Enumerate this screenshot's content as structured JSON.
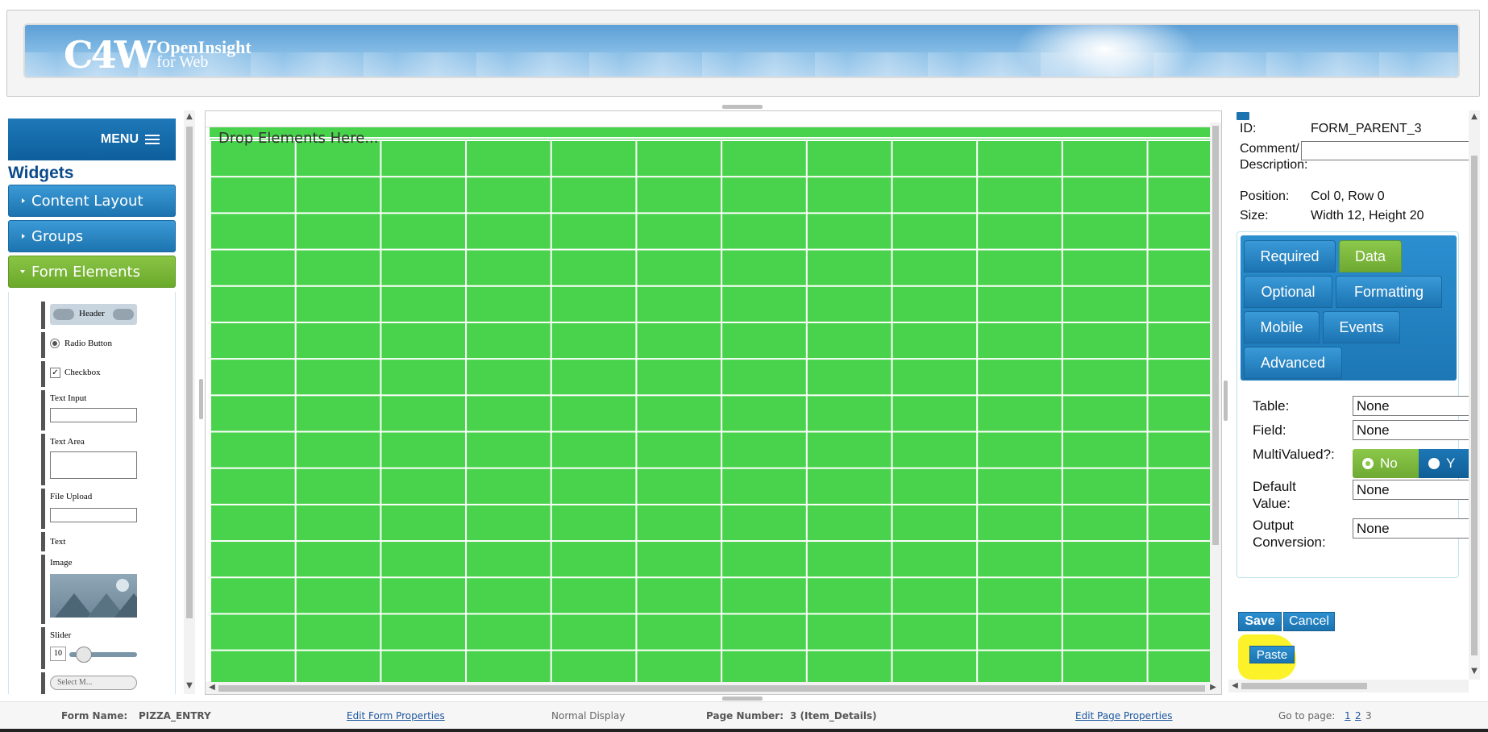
{
  "banner": {
    "logo_mark": "C4W",
    "logo_line1": "OpenInsight",
    "logo_line2": "for Web"
  },
  "left_panel": {
    "menu_label": "MENU",
    "widgets_title": "Widgets",
    "accordion": [
      {
        "label": "Content Layout",
        "state": "collapsed"
      },
      {
        "label": "Groups",
        "state": "collapsed"
      },
      {
        "label": "Form Elements",
        "state": "expanded"
      }
    ],
    "elements": {
      "header": "Header",
      "radio": "Radio Button",
      "checkbox": "Checkbox",
      "checkbox_mark": "✓",
      "text_input": "Text Input",
      "text_area": "Text Area",
      "file_upload": "File Upload",
      "text": "Text",
      "image": "Image",
      "slider": "Slider",
      "slider_value": "10",
      "select_stub": "Select M..."
    }
  },
  "canvas": {
    "drop_text": "Drop Elements Here..."
  },
  "properties": {
    "id_label": "ID:",
    "id_value": "FORM_PARENT_3",
    "comment_label_1": "Comment/",
    "comment_label_2": "Description:",
    "comment_value": "",
    "position_label": "Position:",
    "position_value": "Col 0, Row 0",
    "size_label": "Size:",
    "size_value": "Width 12, Height 20"
  },
  "tabs": [
    {
      "label": "Required",
      "active": false
    },
    {
      "label": "Data",
      "active": true
    },
    {
      "label": "Optional",
      "active": false
    },
    {
      "label": "Formatting",
      "active": false
    },
    {
      "label": "Mobile",
      "active": false
    },
    {
      "label": "Events",
      "active": false
    },
    {
      "label": "Advanced",
      "active": false
    }
  ],
  "data_tab": {
    "table_label": "Table:",
    "table_value": "None",
    "field_label": "Field:",
    "field_value": "None",
    "multivalued_label": "MultiValued?:",
    "mv_no": "No",
    "mv_yes": "Y",
    "mv_selected": "No",
    "default_label_1": "Default",
    "default_label_2": "Value:",
    "default_value": "None",
    "output_label_1": "Output",
    "output_label_2": "Conversion:",
    "output_value": "None"
  },
  "buttons": {
    "save": "Save",
    "cancel": "Cancel",
    "paste": "Paste"
  },
  "footer": {
    "form_name_label": "Form Name:",
    "form_name_value": "PIZZA_ENTRY",
    "edit_form": "Edit Form Properties",
    "display_mode": "Normal Display",
    "page_number_label": "Page Number:",
    "page_number_value": "3 (Item_Details)",
    "edit_page": "Edit Page Properties",
    "goto_label": "Go to page:",
    "pages": [
      "1",
      "2",
      "3"
    ]
  },
  "colors": {
    "grid_green": "#49d34c",
    "accent_blue": "#1c73b0",
    "active_green": "#6ea932",
    "highlight_yellow": "#fcf22a"
  }
}
